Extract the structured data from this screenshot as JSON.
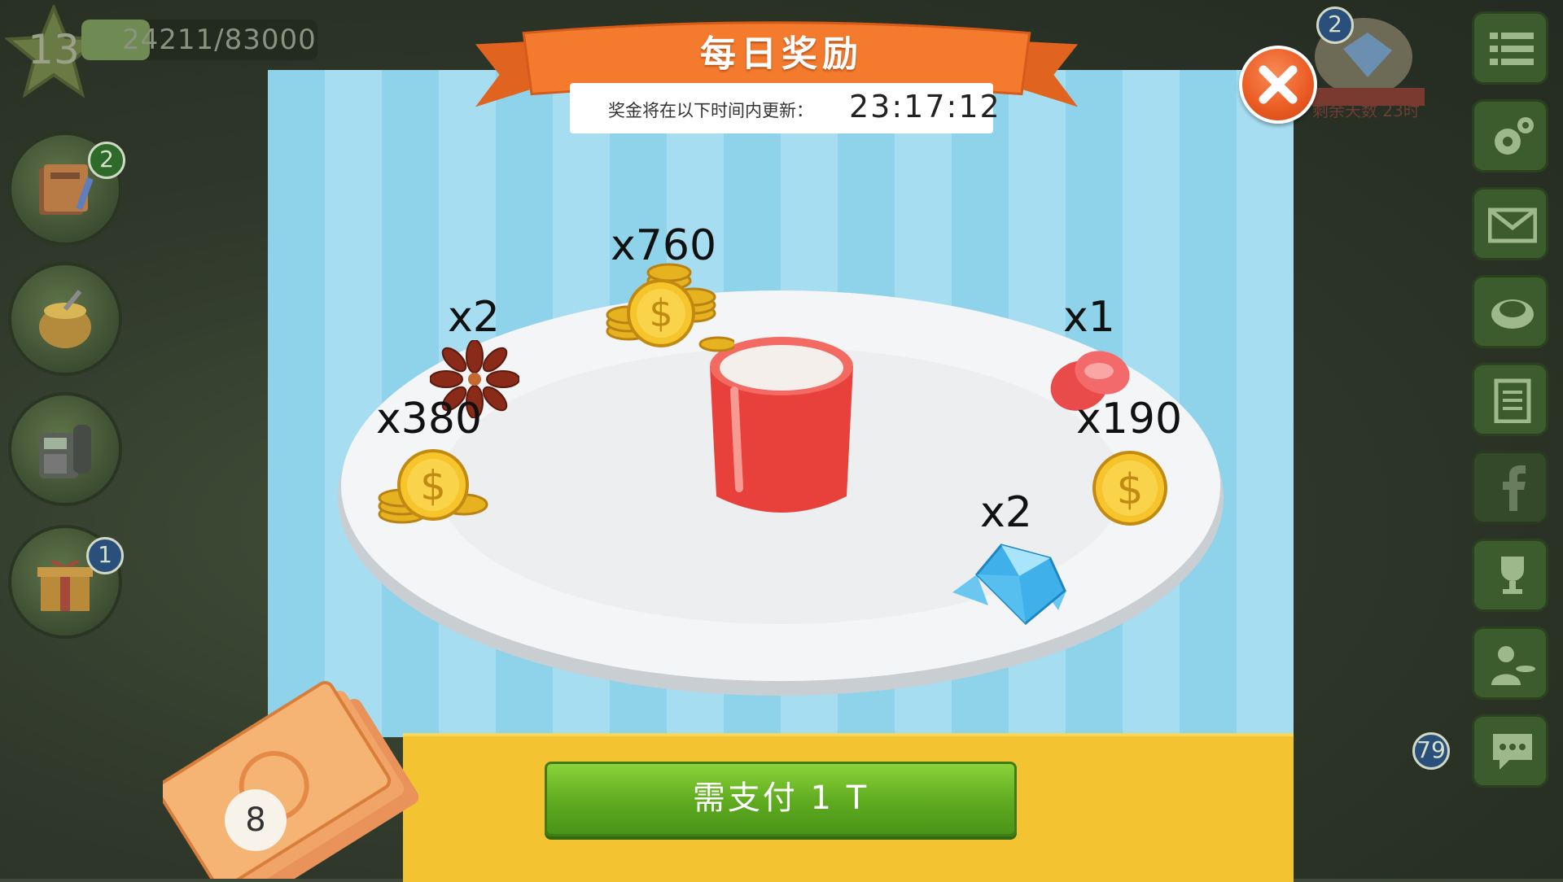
{
  "hud": {
    "level": "13",
    "xp_text": "24211/83000",
    "xp_progress": 0.29
  },
  "side_buttons": [
    {
      "name": "recipe-book",
      "badge": "2"
    },
    {
      "name": "ingredients-sack",
      "badge": ""
    },
    {
      "name": "phone",
      "badge": ""
    },
    {
      "name": "gift-box",
      "badge": "1"
    }
  ],
  "event": {
    "badge": "2",
    "remaining": "剩余天数 23时"
  },
  "oven_badge": "79",
  "dialog": {
    "title": "每日奖励",
    "timer_label": "奖金将在以下时间内更新：",
    "timer_value": "23:17:12"
  },
  "rewards": [
    {
      "icon": "gold-coins-pile-icon",
      "label": "x760"
    },
    {
      "icon": "star-anise-icon",
      "label": "x2"
    },
    {
      "icon": "gold-coins-icon",
      "label": "x380"
    },
    {
      "icon": "rose-petals-icon",
      "label": "x1"
    },
    {
      "icon": "gold-coin-icon",
      "label": "x190"
    },
    {
      "icon": "diamonds-icon",
      "label": "x2"
    }
  ],
  "pay_button": "需支付 1 T",
  "ticket_count": "8",
  "colors": {
    "stripe_light": "#a6ddf0",
    "stripe_dark": "#8fd3ea",
    "footer_yellow": "#f3c332",
    "ribbon_orange": "#f0742d",
    "pay_green": "#5eaa1f",
    "close_orange": "#ea5a22"
  }
}
